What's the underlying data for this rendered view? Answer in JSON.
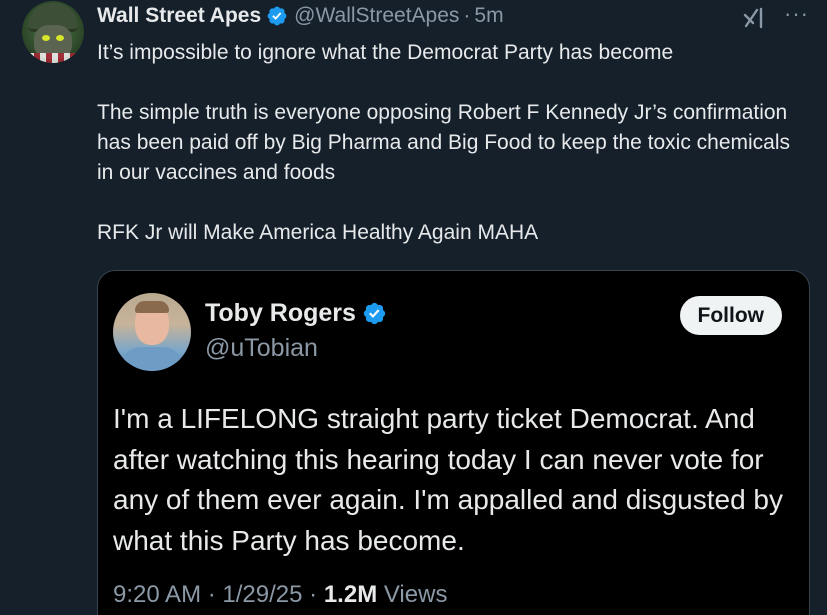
{
  "post": {
    "display_name": "Wall Street Apes",
    "handle": "@WallStreetApes",
    "separator": "·",
    "time": "5m",
    "more_label": "···",
    "paragraphs": [
      "It’s impossible to ignore what the Democrat Party has become",
      "The simple truth is everyone opposing Robert F Kennedy Jr’s confirmation has been paid off by Big Pharma and Big Food to keep the toxic chemicals in our vaccines and foods",
      "RFK Jr will Make America Healthy Again MAHA"
    ]
  },
  "quote": {
    "display_name": "Toby Rogers",
    "handle": "@uTobian",
    "follow_label": "Follow",
    "text": "I'm a LIFELONG straight party ticket Democrat. And after watching this hearing today I can never vote for any of them ever again. I'm appalled and disgusted by what this Party has become.",
    "time": "9:20 AM",
    "date": "1/29/25",
    "separator": "·",
    "views_count": "1.2M",
    "views_label": "Views"
  },
  "colors": {
    "background": "#15202b",
    "quote_background": "#000000",
    "verified_blue": "#1d9bf0",
    "text_primary": "#e7e9ea",
    "text_secondary": "#8b98a5"
  },
  "icons": {
    "verified": "verified-badge-icon",
    "grok": "grok-icon",
    "more": "more-icon"
  }
}
